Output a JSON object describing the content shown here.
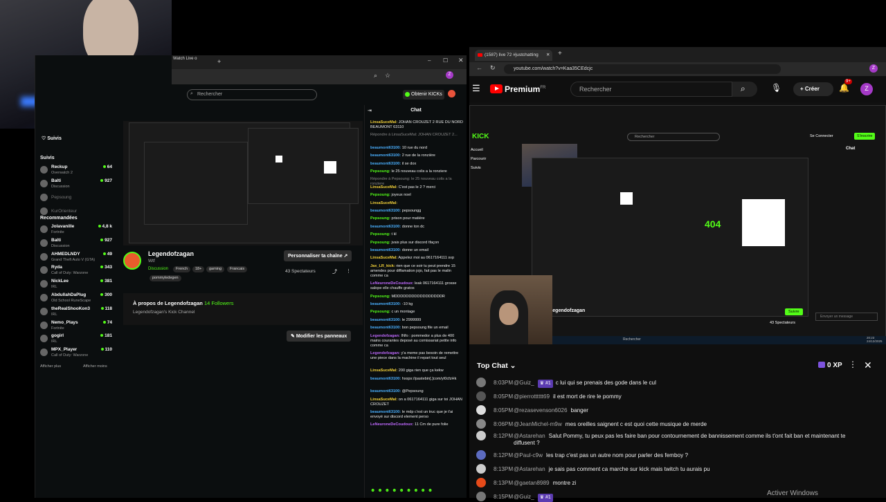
{
  "left_browser": {
    "tab_label": "Watch Live o",
    "search_placeholder": "Rechercher",
    "kicks_button": "Obtenir KICKs",
    "sidebar": {
      "suivis_header": "Suivis",
      "suivis_title": "Suivis",
      "recommended_title": "Recommandées",
      "followed": [
        {
          "name": "Reckup",
          "game": "Overwatch 2",
          "viewers": "64"
        },
        {
          "name": "Balti",
          "game": "Discussion",
          "viewers": "927"
        },
        {
          "name": "Pepsoung",
          "game": "",
          "viewers": ""
        },
        {
          "name": "KurOrienteur",
          "game": "",
          "viewers": ""
        }
      ],
      "recommended": [
        {
          "name": "Jolavanille",
          "game": "Fortnite",
          "viewers": "4,8 k"
        },
        {
          "name": "Balti",
          "game": "Discussion",
          "viewers": "927"
        },
        {
          "name": "AHMEDLNDY",
          "game": "Grand Theft Auto V (GTA)",
          "viewers": "49"
        },
        {
          "name": "Ryda",
          "game": "Call of Duty: Warzone",
          "viewers": "343"
        },
        {
          "name": "NickLee",
          "game": "IRL",
          "viewers": "381"
        },
        {
          "name": "AbdullahDaPlug",
          "game": "Old School RuneScape",
          "viewers": "300"
        },
        {
          "name": "theRealShooKon3",
          "game": "IRL",
          "viewers": "118"
        },
        {
          "name": "Nemo_Plays",
          "game": "Fortnite",
          "viewers": "74"
        },
        {
          "name": "gogirl",
          "game": "IRL",
          "viewers": "181"
        },
        {
          "name": "MPX_Player",
          "game": "Call of Duty: Warzone",
          "viewers": "110"
        }
      ],
      "show_more": "Afficher plus",
      "show_less": "Afficher moins"
    },
    "channel": {
      "name": "Legendofzagan",
      "subtitle": "Wtf",
      "category": "Discussion",
      "tags": [
        "French",
        "18+",
        "gaming",
        "Francais",
        "pommyledegen"
      ],
      "customize_button": "Personnaliser ta chaîne",
      "spectators": "43 Spectateurs",
      "about_title": "À propos de Legendofzagan",
      "followers": "14 Followers",
      "about_desc": "Legendofzagan's Kick Channel",
      "edit_panels": "Modifier les panneaux"
    },
    "chat": {
      "title": "Chat",
      "messages": [
        {
          "user": "LinsaSuceMal:",
          "text": "JOHAN CROUZET 2 RUE DU NORD BEAUMONT 63110",
          "color": "yel"
        },
        {
          "user": "",
          "text": "Répondre à LinsaSuceMal: JOHAN CROUZET 2...",
          "color": ""
        },
        {
          "user": "beaumont63100:",
          "text": "10 rue du nord",
          "color": "blue"
        },
        {
          "user": "beaumont63100:",
          "text": "2 rue de la ronzière",
          "color": "blue"
        },
        {
          "user": "beaumont63100:",
          "text": "il se dox",
          "color": "blue"
        },
        {
          "user": "Pepsoung:",
          "text": "le 25 nouveau colis a la ronziere",
          "color": "gr"
        },
        {
          "user": "",
          "text": "Répondre à Pepsoung: le 25 nouveau colis a la ronziere",
          "color": ""
        },
        {
          "user": "LinsaSuceMal:",
          "text": "C'est pas le 2 ? merci",
          "color": "yel"
        },
        {
          "user": "Pepsoung:",
          "text": "joyeux noel",
          "color": "gr"
        },
        {
          "user": "LinsaSuceMal:",
          "text": "",
          "color": "yel"
        },
        {
          "user": "beaumont63100:",
          "text": "pepsoungg",
          "color": "blue"
        },
        {
          "user": "Pepsoung:",
          "text": "prison pour matière",
          "color": "gr"
        },
        {
          "user": "beaumont63100:",
          "text": "donne ton dc",
          "color": "blue"
        },
        {
          "user": "Pepsoung:",
          "text": "t kl",
          "color": "gr"
        },
        {
          "user": "Pepsoung:",
          "text": "jvais plus sur discord tfaçon",
          "color": "gr"
        },
        {
          "user": "beaumont63100:",
          "text": "donne un email",
          "color": "blue"
        },
        {
          "user": "LinsaSuceMal:",
          "text": "Appelez moi au 0617164111 svp",
          "color": "yel"
        },
        {
          "user": "Jax_LR_kick:",
          "text": "rien que ce soir tu peut prendre 15 amendes pour diffamation jojo, fait pas le malin comme ca",
          "color": "yel"
        },
        {
          "user": "LeNeuroneDeCoudoux:",
          "text": "leak 0617164111 grosse salope elle chauffe gratos",
          "color": "pur"
        },
        {
          "user": "Pepsoung:",
          "text": "MDDDDDDDDDDDDDDDDDR",
          "color": "gr"
        },
        {
          "user": "beaumont63100:",
          "text": "-10 kg",
          "color": "blue"
        },
        {
          "user": "Pepsoung:",
          "text": "c un montage",
          "color": "gr"
        },
        {
          "user": "beaumont63100:",
          "text": "le 2999999",
          "color": "blue"
        },
        {
          "user": "beaumont63100:",
          "text": "bon pepsoung file un email",
          "color": "blue"
        },
        {
          "user": "Legendofzagan:",
          "text": "INfo : pommedor a plus de 400 mains courantes deposé au comissariat petite info comme ca",
          "color": "pur"
        },
        {
          "user": "Legendofzagan:",
          "text": "y'a meme pas besoin de remettre une piece dans la machine il repart tout seul",
          "color": "pur"
        },
        {
          "user": "LinsaSuceMal:",
          "text": "200 giga rien que ça kekw",
          "color": "yel"
        },
        {
          "user": "beaumont63100:",
          "text": "hxxps://pastebin[.]com/yI0cfzHk",
          "color": "blue"
        },
        {
          "user": "beaumont63100:",
          "text": "@Pepsoung",
          "color": "blue"
        },
        {
          "user": "LinsaSuceMal:",
          "text": "on a 0617164111 giga sur toi JOHAN CROUZET",
          "color": "yel"
        },
        {
          "user": "beaumont63100:",
          "text": "le mdp c'est un truc que je t'ai envoyé sur discord element perso",
          "color": "blue"
        },
        {
          "user": "LeNeuroneDeCoudoux:",
          "text": "11 Cm de pure folie",
          "color": "pur"
        }
      ]
    }
  },
  "right_browser": {
    "tab_label": "(1587) live 72 #justchatting",
    "url": "youtube.com/watch?v=Kaa35CEdcjc",
    "logo_text": "Premium",
    "logo_region": "FR",
    "search_placeholder": "Rechercher",
    "create_button": "Créer",
    "notif_count": "9+",
    "avatar_letter": "Z",
    "video": {
      "kick_search": "Rechercher",
      "login": "Se Connecter",
      "signup": "S'inscrire",
      "nav": [
        "Accueil",
        "Parcourir",
        "Suivis"
      ],
      "channel_name": "Legendofzagan",
      "spectators": "43 Spectateurs",
      "follow": "Suivre",
      "chat_input": "Envoyer un message",
      "chat_label": "Chat",
      "taskbar_search": "Rechercher",
      "clock_time": "20:23",
      "clock_date": "24/12/2025"
    },
    "top_chat": {
      "title": "Top Chat",
      "xp": "0 XP",
      "messages": [
        {
          "time": "8:03PM",
          "user": "@Guiz_",
          "badge": "#1",
          "text": "c lui qui se prenais des gode dans le cul",
          "avatar": "#777"
        },
        {
          "time": "8:05PM",
          "user": "@pierrotttttt69",
          "badge": "",
          "text": "il est mort de rire le pommy",
          "avatar": "#555"
        },
        {
          "time": "8:05PM",
          "user": "@rezasevenson6026",
          "badge": "",
          "text": "banger",
          "avatar": "#ddd"
        },
        {
          "time": "8:06PM",
          "user": "@JeanMichel-m9w",
          "badge": "",
          "text": "mes oreilles saignent c est quoi cette musique de merde",
          "avatar": "#888"
        },
        {
          "time": "8:12PM",
          "user": "@Astarehan",
          "badge": "",
          "text": "Salut Pommy, tu peux pas les faire ban pour contournement de bannissement comme ils t'ont fait ban et maintenant te diffusent ?",
          "avatar": "#ccc"
        },
        {
          "time": "8:12PM",
          "user": "@Paul-c9w",
          "badge": "",
          "text": "les trap c'est pas un autre nom pour parler des femboy ?",
          "avatar": "#5c6bc0"
        },
        {
          "time": "8:13PM",
          "user": "@Astarehan",
          "badge": "",
          "text": "je sais pas comment ca marche sur kick mais twitch tu aurais pu",
          "avatar": "#ccc"
        },
        {
          "time": "8:13PM",
          "user": "@gaetan8989",
          "badge": "",
          "text": "montre zi",
          "avatar": "#e64a19"
        },
        {
          "time": "8:15PM",
          "user": "@Guiz_",
          "badge": "#1",
          "text": "",
          "avatar": "#777"
        }
      ]
    }
  },
  "os": {
    "activate_windows": "Activer Windows"
  }
}
